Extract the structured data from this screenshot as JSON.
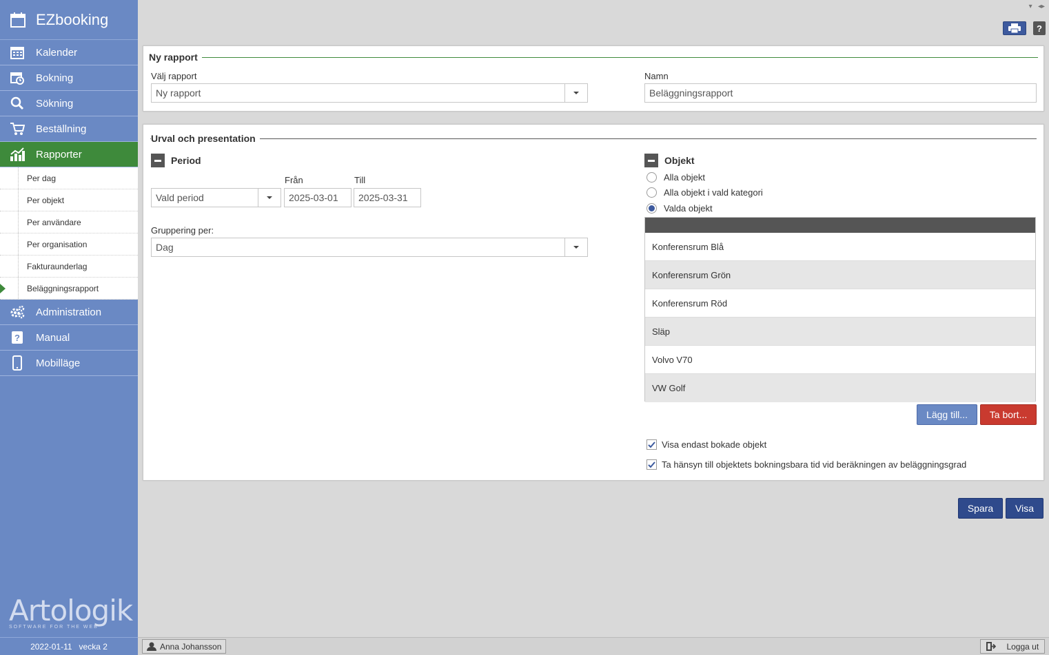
{
  "app": {
    "title": "EZbooking"
  },
  "sidebar": {
    "items": [
      {
        "label": "Kalender",
        "icon": "calendar-icon"
      },
      {
        "label": "Bokning",
        "icon": "booking-icon"
      },
      {
        "label": "Sökning",
        "icon": "search-icon"
      },
      {
        "label": "Beställning",
        "icon": "cart-icon"
      },
      {
        "label": "Rapporter",
        "icon": "chart-icon",
        "active": true
      },
      {
        "label": "Administration",
        "icon": "gears-icon"
      },
      {
        "label": "Manual",
        "icon": "manual-icon"
      },
      {
        "label": "Mobilläge",
        "icon": "mobile-icon"
      }
    ],
    "subitems": [
      {
        "label": "Per dag"
      },
      {
        "label": "Per objekt"
      },
      {
        "label": "Per användare"
      },
      {
        "label": "Per organisation"
      },
      {
        "label": "Fakturaunderlag"
      },
      {
        "label": "Beläggningsrapport",
        "current": true
      }
    ],
    "logo_text": "Artologik",
    "logo_tagline": "SOFTWARE FOR THE WEB",
    "footer_date": "2022-01-11   vecka 2"
  },
  "report": {
    "panel_title": "Ny rapport",
    "select_label": "Välj rapport",
    "select_value": "Ny rapport",
    "name_label": "Namn",
    "name_value": "Beläggningsrapport"
  },
  "selection": {
    "panel_title": "Urval och presentation",
    "period": {
      "title": "Period",
      "type_value": "Vald period",
      "from_label": "Från",
      "from_value": "2025-03-01",
      "to_label": "Till",
      "to_value": "2025-03-31"
    },
    "grouping": {
      "label": "Gruppering per:",
      "value": "Dag"
    },
    "objects": {
      "title": "Objekt",
      "radios": [
        {
          "label": "Alla objekt",
          "selected": false
        },
        {
          "label": "Alla objekt i vald kategori",
          "selected": false
        },
        {
          "label": "Valda objekt",
          "selected": true
        }
      ],
      "list": [
        "Konferensrum Blå",
        "Konferensrum Grön",
        "Konferensrum Röd",
        "Släp",
        "Volvo V70",
        "VW Golf"
      ],
      "add_button": "Lägg till...",
      "remove_button": "Ta bort..."
    },
    "checkboxes": [
      {
        "label": "Visa endast bokade objekt",
        "checked": true
      },
      {
        "label": "Ta hänsyn till objektets bokningsbara tid vid beräkningen av beläggningsgrad",
        "checked": true
      }
    ]
  },
  "actions": {
    "save": "Spara",
    "show": "Visa"
  },
  "status": {
    "user": "Anna Johansson",
    "logout": "Logga ut"
  },
  "colors": {
    "sidebar": "#6a89c4",
    "active": "#3e8a3b",
    "primary": "#2f4a8c",
    "danger": "#c93a2f"
  }
}
